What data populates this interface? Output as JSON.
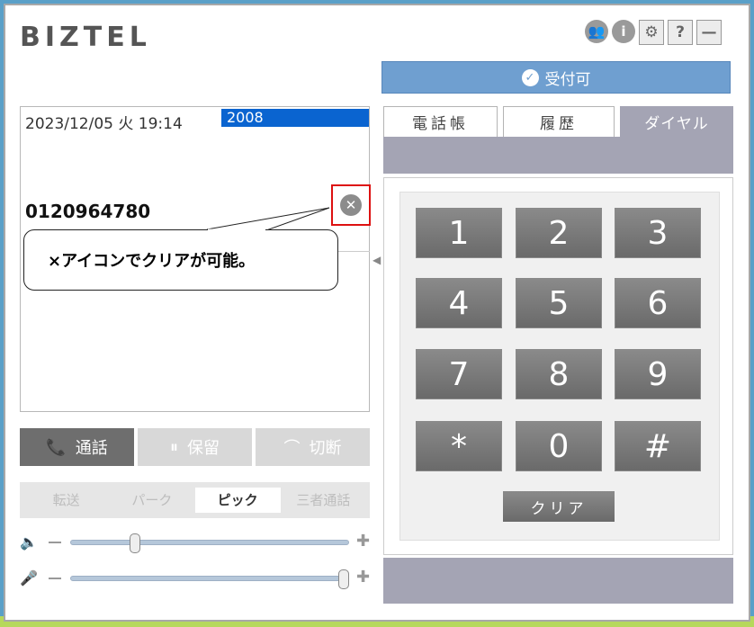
{
  "header": {
    "logo": "BIZTEL",
    "icons": [
      {
        "name": "users-icon",
        "glyph": "👥"
      },
      {
        "name": "info-icon",
        "glyph": "i"
      },
      {
        "name": "gear-icon",
        "glyph": "⚙"
      },
      {
        "name": "help-icon",
        "glyph": "?"
      },
      {
        "name": "minimize-icon",
        "glyph": "—"
      }
    ]
  },
  "status": {
    "label": "受付可",
    "color": "#6f9fd0"
  },
  "call_panel": {
    "datetime": "2023/12/05 火 19:14",
    "extension": "2008",
    "phone_number": "0120964780"
  },
  "annotation": {
    "text": "×アイコンでクリアが可能。"
  },
  "call_controls": [
    {
      "label": "通話",
      "icon": "📞",
      "active": true
    },
    {
      "label": "保留",
      "icon": "⏸",
      "active": false
    },
    {
      "label": "切断",
      "icon": "⌒",
      "active": false
    }
  ],
  "transfer_tabs": [
    {
      "label": "転送",
      "selected": false
    },
    {
      "label": "パーク",
      "selected": false
    },
    {
      "label": "ピック",
      "selected": true
    },
    {
      "label": "三者通話",
      "selected": false
    }
  ],
  "volume": {
    "speaker_level": 0.22,
    "mic_level": 1.0
  },
  "tabs": [
    {
      "label": "電話帳",
      "active": false
    },
    {
      "label": "履歴",
      "active": false
    },
    {
      "label": "ダイヤル",
      "active": true
    }
  ],
  "dialpad": {
    "keys": [
      "1",
      "2",
      "3",
      "4",
      "5",
      "6",
      "7",
      "8",
      "9",
      "*",
      "0",
      "#"
    ],
    "clear_label": "クリア"
  }
}
